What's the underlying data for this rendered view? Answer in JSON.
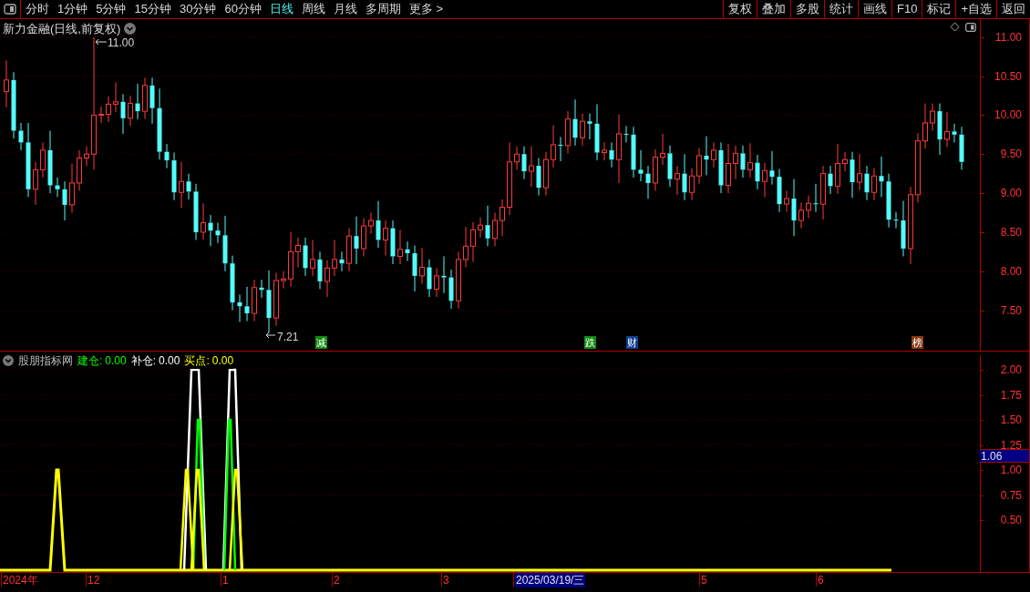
{
  "toolbar": {
    "periods": [
      {
        "label": "分时",
        "selected": false
      },
      {
        "label": "1分钟",
        "selected": false
      },
      {
        "label": "5分钟",
        "selected": false
      },
      {
        "label": "15分钟",
        "selected": false
      },
      {
        "label": "30分钟",
        "selected": false
      },
      {
        "label": "60分钟",
        "selected": false
      },
      {
        "label": "日线",
        "selected": true
      },
      {
        "label": "周线",
        "selected": false
      },
      {
        "label": "月线",
        "selected": false
      },
      {
        "label": "多周期",
        "selected": false
      },
      {
        "label": "更多 >",
        "selected": false
      }
    ],
    "buttons": [
      "复权",
      "叠加",
      "多股",
      "统计",
      "画线",
      "F10",
      "标记",
      "+自选",
      "返回"
    ]
  },
  "main_chart": {
    "title": "新力金融(日线,前复权)",
    "high_label": "11.00",
    "low_label": "7.21",
    "markers": [
      {
        "label": "减",
        "color": "#118a11"
      },
      {
        "label": "跌",
        "color": "#118a11"
      },
      {
        "label": "财",
        "color": "#0f3f8f"
      },
      {
        "label": "榜",
        "color": "#8a3a14"
      }
    ],
    "chart_data": {
      "type": "candlestick",
      "grid": true,
      "ylim": [
        6.97,
        11.23
      ],
      "yticks": [
        {
          "value": 11,
          "label": "11.00"
        },
        {
          "value": 10.5,
          "label": "10.50"
        },
        {
          "value": 10,
          "label": "10.00"
        },
        {
          "value": 9.5,
          "label": "9.50"
        },
        {
          "value": 9,
          "label": "9.00"
        },
        {
          "value": 8.5,
          "label": "8.50"
        },
        {
          "value": 8,
          "label": "8.00"
        },
        {
          "value": 7.5,
          "label": "7.50"
        }
      ],
      "ohlc": [
        [
          10.3,
          10.7,
          10.1,
          10.45
        ],
        [
          10.45,
          10.55,
          9.7,
          9.8
        ],
        [
          9.8,
          9.9,
          9.55,
          9.65
        ],
        [
          9.65,
          9.9,
          8.95,
          9.05
        ],
        [
          9.05,
          9.4,
          8.85,
          9.3
        ],
        [
          9.3,
          9.65,
          9.2,
          9.55
        ],
        [
          9.55,
          9.8,
          9.0,
          9.1
        ],
        [
          9.1,
          9.2,
          8.95,
          9.05
        ],
        [
          9.05,
          9.15,
          8.65,
          8.85
        ],
        [
          8.85,
          9.38,
          8.75,
          9.13
        ],
        [
          9.13,
          9.55,
          9.03,
          9.45
        ],
        [
          9.45,
          9.6,
          9.35,
          9.5
        ],
        [
          9.5,
          11.0,
          9.3,
          10.0
        ],
        [
          10.0,
          10.11,
          9.9,
          10.01
        ],
        [
          10.01,
          10.24,
          9.91,
          10.14
        ],
        [
          10.14,
          10.42,
          10.04,
          10.17
        ],
        [
          10.17,
          10.27,
          9.76,
          9.96
        ],
        [
          9.96,
          10.25,
          9.86,
          10.15
        ],
        [
          10.15,
          10.4,
          9.95,
          10.05
        ],
        [
          10.05,
          10.48,
          9.95,
          10.38
        ],
        [
          10.38,
          10.48,
          9.89,
          10.09
        ],
        [
          10.09,
          10.34,
          9.43,
          9.53
        ],
        [
          9.53,
          9.63,
          9.32,
          9.42
        ],
        [
          9.42,
          9.52,
          8.91,
          9.01
        ],
        [
          9.01,
          9.4,
          8.81,
          9.15
        ],
        [
          9.15,
          9.25,
          8.92,
          9.02
        ],
        [
          9.02,
          9.12,
          8.4,
          8.5
        ],
        [
          8.5,
          8.87,
          8.4,
          8.62
        ],
        [
          8.62,
          8.72,
          8.32,
          8.52
        ],
        [
          8.52,
          8.62,
          8.36,
          8.46
        ],
        [
          8.46,
          8.71,
          8.0,
          8.1
        ],
        [
          8.1,
          8.2,
          7.5,
          7.6
        ],
        [
          7.6,
          7.7,
          7.35,
          7.55
        ],
        [
          7.55,
          7.8,
          7.36,
          7.46
        ],
        [
          7.46,
          7.89,
          7.36,
          7.79
        ],
        [
          7.79,
          7.89,
          7.66,
          7.76
        ],
        [
          7.76,
          8.01,
          7.21,
          7.4
        ],
        [
          7.4,
          7.98,
          7.3,
          7.88
        ],
        [
          7.88,
          8.0,
          7.78,
          7.9
        ],
        [
          7.9,
          8.5,
          7.8,
          8.25
        ],
        [
          8.25,
          8.43,
          8.05,
          8.33
        ],
        [
          8.33,
          8.43,
          7.94,
          8.04
        ],
        [
          8.04,
          8.4,
          7.94,
          8.15
        ],
        [
          8.15,
          8.25,
          7.77,
          7.87
        ],
        [
          7.87,
          8.14,
          7.67,
          8.04
        ],
        [
          8.04,
          8.4,
          7.94,
          8.15
        ],
        [
          8.15,
          8.25,
          8.0,
          8.1
        ],
        [
          8.1,
          8.55,
          8.0,
          8.45
        ],
        [
          8.45,
          8.7,
          8.09,
          8.29
        ],
        [
          8.29,
          8.68,
          8.19,
          8.58
        ],
        [
          8.58,
          8.75,
          8.48,
          8.65
        ],
        [
          8.65,
          8.9,
          8.3,
          8.4
        ],
        [
          8.4,
          8.65,
          8.2,
          8.55
        ],
        [
          8.55,
          8.65,
          8.09,
          8.19
        ],
        [
          8.19,
          8.53,
          8.09,
          8.28
        ],
        [
          8.28,
          8.38,
          8.13,
          8.23
        ],
        [
          8.23,
          8.33,
          7.74,
          7.94
        ],
        [
          7.94,
          8.3,
          7.84,
          8.05
        ],
        [
          8.05,
          8.15,
          7.67,
          7.77
        ],
        [
          7.77,
          8.04,
          7.67,
          7.94
        ],
        [
          7.94,
          8.19,
          7.72,
          7.92
        ],
        [
          7.92,
          8.02,
          7.52,
          7.62
        ],
        [
          7.62,
          8.25,
          7.52,
          8.15
        ],
        [
          8.15,
          8.57,
          8.05,
          8.32
        ],
        [
          8.32,
          8.63,
          8.12,
          8.53
        ],
        [
          8.53,
          8.69,
          8.43,
          8.59
        ],
        [
          8.59,
          8.84,
          8.32,
          8.42
        ],
        [
          8.42,
          8.75,
          8.32,
          8.65
        ],
        [
          8.65,
          8.92,
          8.45,
          8.82
        ],
        [
          8.82,
          9.65,
          8.72,
          9.4
        ],
        [
          9.4,
          9.6,
          9.3,
          9.5
        ],
        [
          9.5,
          9.6,
          9.18,
          9.28
        ],
        [
          9.28,
          9.6,
          9.08,
          9.35
        ],
        [
          9.35,
          9.45,
          8.97,
          9.07
        ],
        [
          9.07,
          9.53,
          8.97,
          9.43
        ],
        [
          9.43,
          9.87,
          9.33,
          9.62
        ],
        [
          9.62,
          9.72,
          9.41,
          9.61
        ],
        [
          9.61,
          10.05,
          9.51,
          9.95
        ],
        [
          9.95,
          10.2,
          9.61,
          9.71
        ],
        [
          9.71,
          10.02,
          9.61,
          9.92
        ],
        [
          9.92,
          10.02,
          9.69,
          9.89
        ],
        [
          9.89,
          10.14,
          9.42,
          9.52
        ],
        [
          9.52,
          9.65,
          9.42,
          9.55
        ],
        [
          9.55,
          9.65,
          9.33,
          9.43
        ],
        [
          9.43,
          10.01,
          9.13,
          9.76
        ],
        [
          9.76,
          9.86,
          9.65,
          9.75
        ],
        [
          9.75,
          9.85,
          9.2,
          9.3
        ],
        [
          9.3,
          9.55,
          9.15,
          9.25
        ],
        [
          9.25,
          9.35,
          8.93,
          9.13
        ],
        [
          9.13,
          9.56,
          9.03,
          9.46
        ],
        [
          9.46,
          9.76,
          9.36,
          9.51
        ],
        [
          9.51,
          9.61,
          9.08,
          9.18
        ],
        [
          9.18,
          9.35,
          8.98,
          9.25
        ],
        [
          9.25,
          9.5,
          8.91,
          9.01
        ],
        [
          9.01,
          9.32,
          8.91,
          9.22
        ],
        [
          9.22,
          9.58,
          9.12,
          9.48
        ],
        [
          9.48,
          9.73,
          9.23,
          9.43
        ],
        [
          9.43,
          9.65,
          9.33,
          9.55
        ],
        [
          9.55,
          9.65,
          9.0,
          9.1
        ],
        [
          9.1,
          9.63,
          9.0,
          9.38
        ],
        [
          9.38,
          9.61,
          9.18,
          9.51
        ],
        [
          9.51,
          9.61,
          9.2,
          9.3
        ],
        [
          9.3,
          9.64,
          9.2,
          9.39
        ],
        [
          9.39,
          9.49,
          9.05,
          9.15
        ],
        [
          9.15,
          9.39,
          8.95,
          9.29
        ],
        [
          9.29,
          9.54,
          9.11,
          9.21
        ],
        [
          9.21,
          9.31,
          8.76,
          8.86
        ],
        [
          8.86,
          9.03,
          8.76,
          8.93
        ],
        [
          8.93,
          9.18,
          8.45,
          8.65
        ],
        [
          8.65,
          8.88,
          8.55,
          8.78
        ],
        [
          8.78,
          8.97,
          8.68,
          8.87
        ],
        [
          8.87,
          9.12,
          8.76,
          8.86
        ],
        [
          8.86,
          9.35,
          8.66,
          9.25
        ],
        [
          9.25,
          9.35,
          8.99,
          9.09
        ],
        [
          9.09,
          9.63,
          8.99,
          9.38
        ],
        [
          9.38,
          9.53,
          9.28,
          9.43
        ],
        [
          9.43,
          9.53,
          8.94,
          9.14
        ],
        [
          9.14,
          9.5,
          9.04,
          9.25
        ],
        [
          9.25,
          9.35,
          8.91,
          9.01
        ],
        [
          9.01,
          9.32,
          8.91,
          9.22
        ],
        [
          9.22,
          9.47,
          8.95,
          9.15
        ],
        [
          9.15,
          9.25,
          8.56,
          8.66
        ],
        [
          8.66,
          8.76,
          8.55,
          8.65
        ],
        [
          8.65,
          8.9,
          8.19,
          8.29
        ],
        [
          8.29,
          9.08,
          8.09,
          8.98
        ],
        [
          8.98,
          9.77,
          8.88,
          9.67
        ],
        [
          9.67,
          10.15,
          9.57,
          9.9
        ],
        [
          9.9,
          10.15,
          9.8,
          10.05
        ],
        [
          10.05,
          10.15,
          9.49,
          9.69
        ],
        [
          9.69,
          10.04,
          9.59,
          9.79
        ],
        [
          9.79,
          9.89,
          9.65,
          9.75
        ],
        [
          9.75,
          9.85,
          9.3,
          9.4
        ]
      ]
    }
  },
  "indicator": {
    "name": "股朋指标网",
    "values": [
      {
        "label": "建仓:",
        "value": "0.00",
        "color": "#00ff00"
      },
      {
        "label": "补仓:",
        "value": "0.00",
        "color": "#ffffff"
      },
      {
        "label": "买点:",
        "value": "0.00",
        "color": "#ffff00"
      }
    ],
    "axis_labels": [
      "2.00",
      "1.75",
      "1.50",
      "1.25",
      "1.00",
      "0.75",
      "0.50"
    ],
    "cursor_value": "1.06"
  },
  "date_axis": [
    {
      "text": "2024年",
      "kind": "tick"
    },
    {
      "text": "12",
      "kind": "tick"
    },
    {
      "text": "1",
      "kind": "tick"
    },
    {
      "text": "2",
      "kind": "tick"
    },
    {
      "text": "3",
      "kind": "tick"
    },
    {
      "text": "2025/03/19/三",
      "kind": "cursor"
    },
    {
      "text": "5",
      "kind": "tick"
    },
    {
      "text": "6",
      "kind": "tick"
    }
  ]
}
